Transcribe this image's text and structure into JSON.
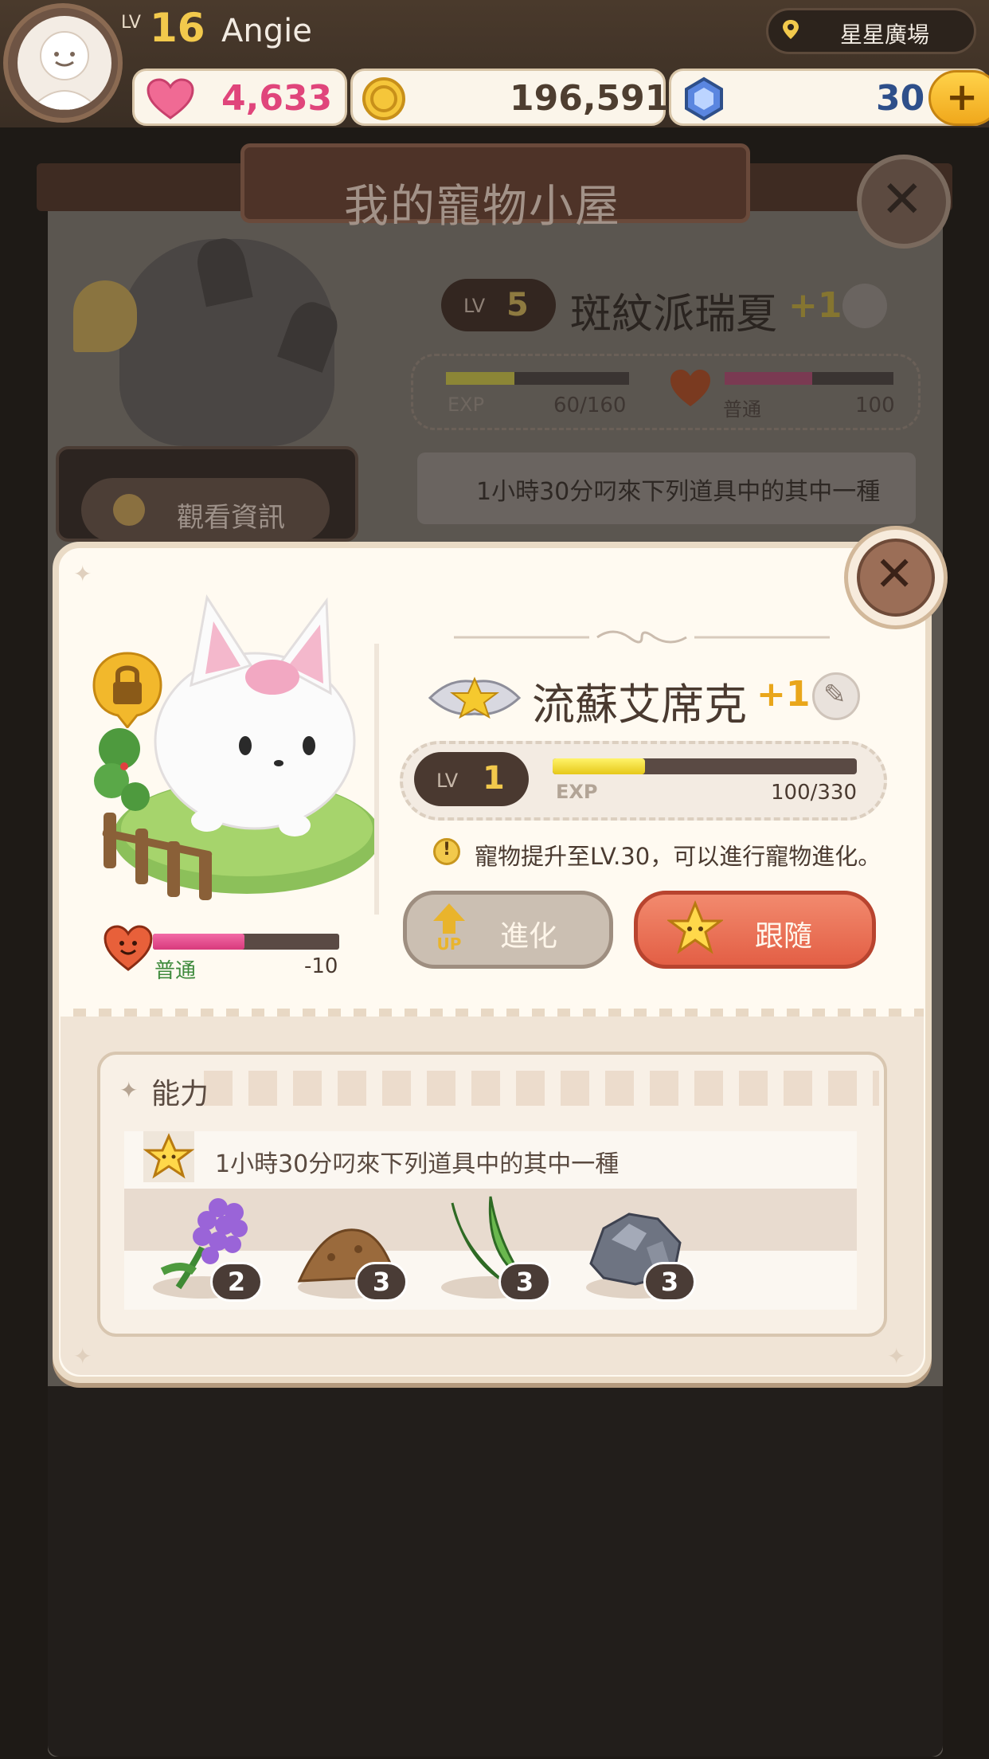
{
  "player": {
    "level_tag": "LV",
    "level": "16",
    "name": "Angie",
    "location": "星星廣場"
  },
  "currencies": {
    "hearts": "4,633",
    "coins": "196,591",
    "gems": "30",
    "plus_label": "+"
  },
  "background_screen": {
    "title": "我的寵物小屋",
    "close_label": "✕",
    "info_button": "觀看資訊",
    "pet": {
      "level_tag": "LV",
      "level": "5",
      "name": "斑紋派瑞夏",
      "plus": "+1",
      "exp_label": "EXP",
      "exp": "60/160",
      "exp_progress": 0.375,
      "affection_label": "普通",
      "affection": "100",
      "affection_progress": 0.52
    },
    "ability_text": "1小時30分叼來下列道具中的其中一種"
  },
  "modal": {
    "close_label": "✕",
    "pet": {
      "name": "流蘇艾席克",
      "plus": "+1",
      "level_tag": "LV",
      "level": "1",
      "exp_label": "EXP",
      "exp": "100/330",
      "exp_progress": 0.303,
      "affection_label": "普通",
      "affection": "-10",
      "affection_progress": 0.49
    },
    "evolve_note": "寵物提升至LV.30，可以進行寵物進化。",
    "evolve_button": "進化",
    "evolve_up_label": "UP",
    "follow_button": "跟隨",
    "ability": {
      "title": "能力",
      "text": "1小時30分叼來下列道具中的其中一種",
      "items": [
        {
          "icon": "purple-flower-icon",
          "count": "2"
        },
        {
          "icon": "dirt-pile-icon",
          "count": "3"
        },
        {
          "icon": "green-leaf-icon",
          "count": "3"
        },
        {
          "icon": "ore-rock-icon",
          "count": "3"
        }
      ]
    }
  },
  "colors": {
    "heart": "#e0457b",
    "gold": "#f2c94c",
    "gem": "#2e4f8a",
    "follow": "#e35f45",
    "evolve_disabled": "#cbbfb2"
  }
}
